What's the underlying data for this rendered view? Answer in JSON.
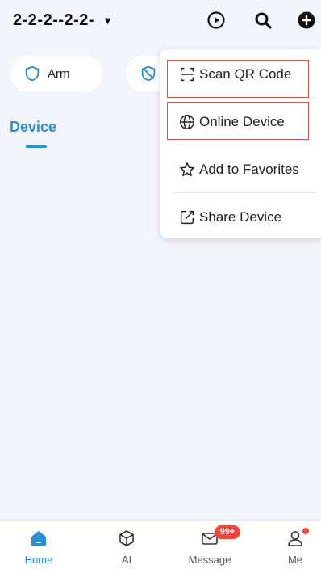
{
  "header": {
    "home_name": "2-2-2--2-2-",
    "caret": "▼"
  },
  "quick_actions": [
    {
      "label": "Arm",
      "icon": "shield-icon"
    },
    {
      "label": "",
      "icon": "shield-off-icon"
    }
  ],
  "tabs": [
    {
      "label": "Device",
      "active": true
    }
  ],
  "menu": {
    "items": [
      {
        "label": "Scan QR Code",
        "icon": "scan-icon",
        "highlighted": true
      },
      {
        "label": "Online Device",
        "icon": "globe-icon",
        "highlighted": true
      },
      {
        "label": "Add to Favorites",
        "icon": "star-icon",
        "highlighted": false
      },
      {
        "label": "Share Device",
        "icon": "share-icon",
        "highlighted": false
      }
    ]
  },
  "bottom_nav": {
    "items": [
      {
        "label": "Home",
        "icon": "home-icon",
        "active": true
      },
      {
        "label": "AI",
        "icon": "cube-icon"
      },
      {
        "label": "Message",
        "icon": "mail-icon",
        "badge": "99+"
      },
      {
        "label": "Me",
        "icon": "user-icon",
        "dot": true
      }
    ]
  },
  "colors": {
    "accent": "#2b8fd4",
    "background": "#f2f5fb",
    "highlight_border": "#d9534f",
    "badge": "#f0453b"
  }
}
